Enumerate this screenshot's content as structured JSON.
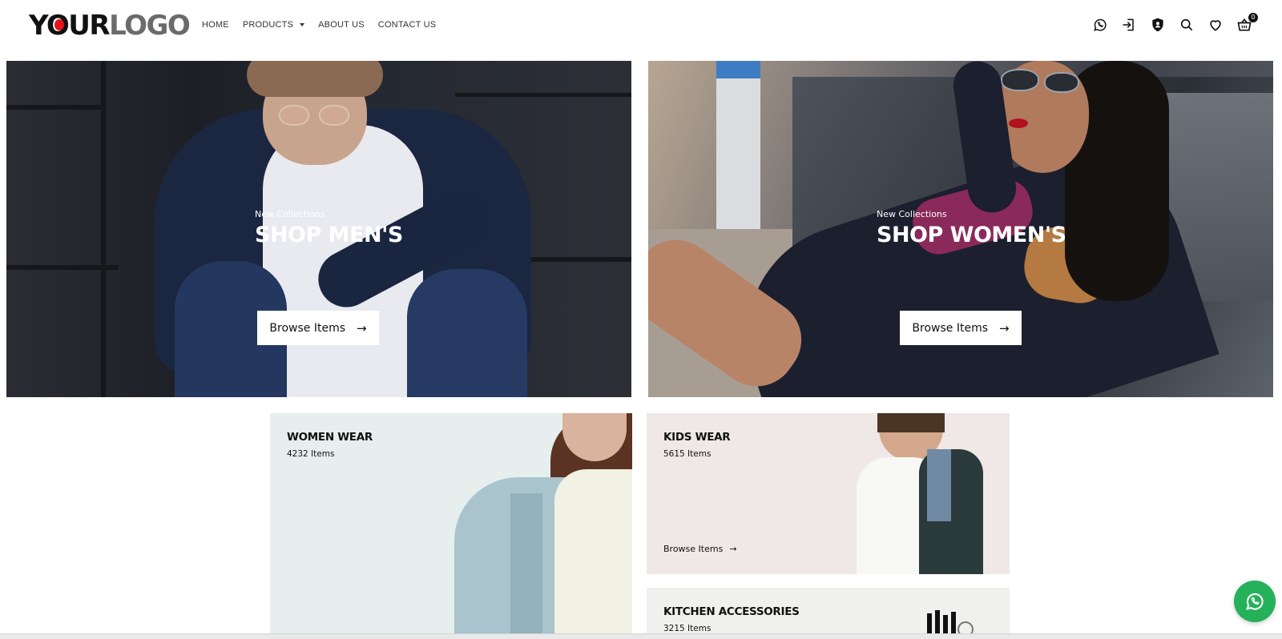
{
  "header": {
    "logo": {
      "part1": "YOUR",
      "part2": "LOGO"
    },
    "nav": [
      {
        "label": "HOME"
      },
      {
        "label": "PRODUCTS",
        "has_dropdown": true
      },
      {
        "label": "ABOUT US"
      },
      {
        "label": "CONTACT US"
      }
    ],
    "icons": [
      "whatsapp-icon",
      "login-icon",
      "shield-icon",
      "search-icon",
      "heart-icon",
      "basket-icon"
    ],
    "cart_count": "0"
  },
  "heroes": [
    {
      "subtitle": "New Collections",
      "title": "SHOP MEN'S",
      "button": "Browse Items",
      "button_icon": "arrow-right-icon"
    },
    {
      "subtitle": "New Collections",
      "title": "SHOP WOMEN'S",
      "button": "Browse Items",
      "button_icon": "arrow-right-icon"
    }
  ],
  "categories": [
    {
      "title": "WOMEN WEAR",
      "count": "4232 Items"
    },
    {
      "title": "KIDS WEAR",
      "count": "5615 Items",
      "link": "Browse Items"
    },
    {
      "title": "KITCHEN ACCESSORIES",
      "count": "3215 Items"
    }
  ],
  "floating": {
    "icon": "whatsapp-icon",
    "color": "#25b05a"
  },
  "colors": {
    "logo_dot": "#e3141b",
    "text": "#111111",
    "logo_gray": "#6b6b6b"
  }
}
